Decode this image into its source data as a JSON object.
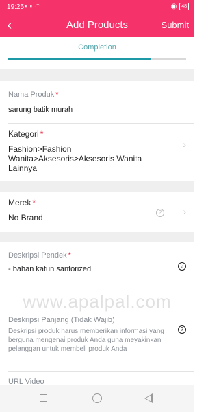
{
  "status_bar": {
    "time": "19:25",
    "system_icons": "▪ ▪ ◠",
    "battery": "48"
  },
  "header": {
    "back_icon": "‹",
    "title": "Add Products",
    "submit_label": "Submit"
  },
  "completion": {
    "label": "Completion",
    "progress": 0.8
  },
  "form": {
    "nama_produk": {
      "label": "Nama Produk",
      "required": "*",
      "value": "sarung batik murah"
    },
    "kategori": {
      "label": "Kategori",
      "required": "*",
      "value": "Fashion>Fashion Wanita>Aksesoris>Aksesoris Wanita Lainnya",
      "chevron": "›"
    },
    "merek": {
      "label": "Merek",
      "required": "*",
      "value": "No Brand",
      "help": "?",
      "chevron": "›"
    },
    "deskripsi_pendek": {
      "label": "Deskripsi Pendek",
      "required": "*",
      "value": "- bahan katun sanforized",
      "help": "?"
    },
    "deskripsi_panjang": {
      "label": "Deskripsi Panjang (Tidak Wajib)",
      "placeholder": "Deskripsi produk harus memberikan informasi yang berguna mengenai produk Anda guna meyakinkan pelanggan untuk membeli produk Anda",
      "help": "?"
    },
    "url_video": {
      "label": "URL Video"
    }
  },
  "watermark": "www.apalpal.com",
  "colors": {
    "brand": "#f5326a",
    "progress": "#1e9aa7",
    "required": "#e8233c"
  }
}
